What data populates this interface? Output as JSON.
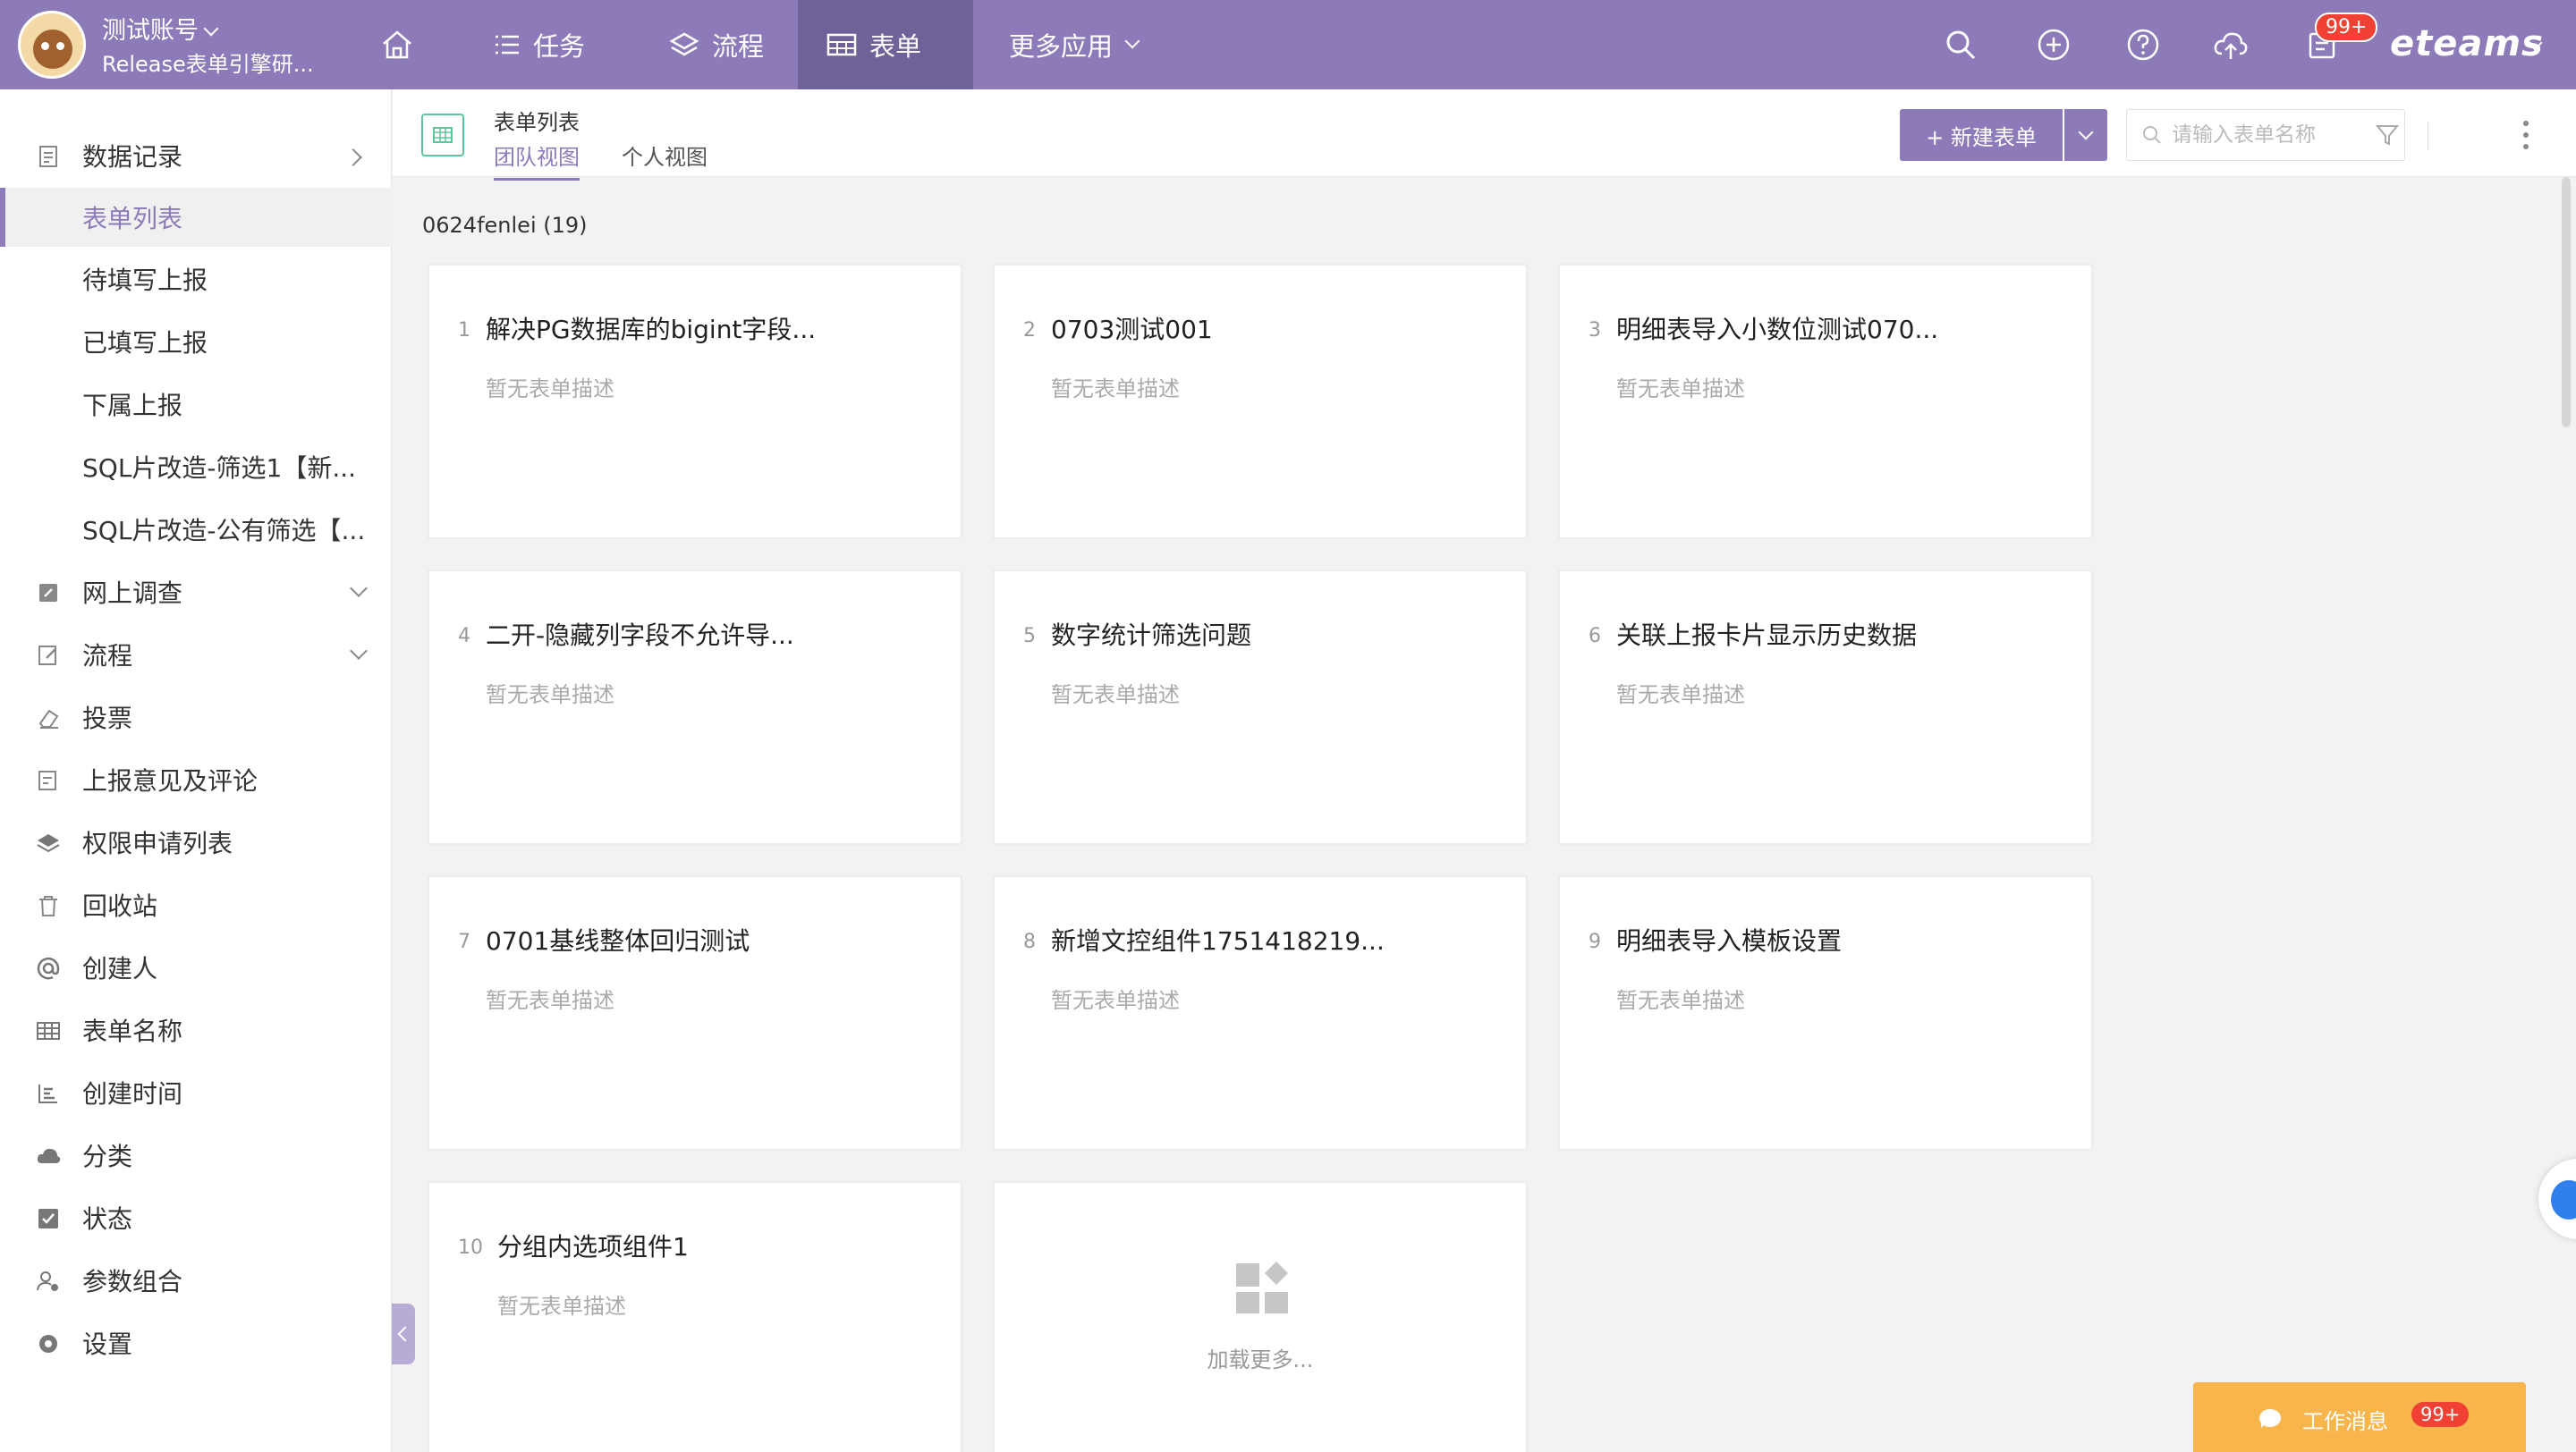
{
  "user": {
    "name": "测试账号",
    "subtitle": "Release表单引擎研..."
  },
  "nav": [
    {
      "label": "任务",
      "icon": "list-icon"
    },
    {
      "label": "流程",
      "icon": "layers-icon"
    },
    {
      "label": "表单",
      "icon": "table-icon"
    },
    {
      "label": "更多应用",
      "icon": "chevron-down-icon"
    }
  ],
  "top_tools": {
    "notification_badge": "99+",
    "brand": "eteams"
  },
  "sidebar": {
    "items": [
      {
        "label": "数据记录",
        "icon": "document-icon"
      },
      {
        "label": "表单列表",
        "icon": ""
      },
      {
        "label": "待填写上报",
        "icon": ""
      },
      {
        "label": "已填写上报",
        "icon": ""
      },
      {
        "label": "下属上报",
        "icon": ""
      },
      {
        "label": "SQL片改造-筛选1【新...",
        "icon": ""
      },
      {
        "label": "SQL片改造-公有筛选【...",
        "icon": ""
      },
      {
        "label": "网上调查",
        "icon": "edit-icon"
      },
      {
        "label": "流程",
        "icon": "flow-edit-icon"
      },
      {
        "label": "投票",
        "icon": "eraser-icon"
      },
      {
        "label": "上报意见及评论",
        "icon": "report-icon"
      },
      {
        "label": "权限申请列表",
        "icon": "layers-icon"
      },
      {
        "label": "回收站",
        "icon": "trash-icon"
      },
      {
        "label": "创建人",
        "icon": "at-icon"
      },
      {
        "label": "表单名称",
        "icon": "table-icon"
      },
      {
        "label": "创建时间",
        "icon": "bar-chart-icon"
      },
      {
        "label": "分类",
        "icon": "cloud-icon"
      },
      {
        "label": "状态",
        "icon": "checkbox-icon"
      },
      {
        "label": "参数组合",
        "icon": "user-settings-icon"
      },
      {
        "label": "设置",
        "icon": "gear-icon"
      }
    ]
  },
  "header": {
    "title": "表单列表",
    "tabs": [
      "团队视图",
      "个人视图"
    ],
    "new_button": "+ 新建表单",
    "search_placeholder": "请输入表单名称"
  },
  "group": {
    "name": "0624fenlei (19)"
  },
  "forms": [
    {
      "num": "1",
      "title": "解决PG数据库的bigint字段...",
      "desc": "暂无表单描述"
    },
    {
      "num": "2",
      "title": "0703测试001",
      "desc": "暂无表单描述"
    },
    {
      "num": "3",
      "title": "明细表导入小数位测试070...",
      "desc": "暂无表单描述"
    },
    {
      "num": "4",
      "title": "二开-隐藏列字段不允许导...",
      "desc": "暂无表单描述"
    },
    {
      "num": "5",
      "title": "数字统计筛选问题",
      "desc": "暂无表单描述"
    },
    {
      "num": "6",
      "title": "关联上报卡片显示历史数据",
      "desc": "暂无表单描述"
    },
    {
      "num": "7",
      "title": "0701基线整体回归测试",
      "desc": "暂无表单描述"
    },
    {
      "num": "8",
      "title": "新增文控组件1751418219...",
      "desc": "暂无表单描述"
    },
    {
      "num": "9",
      "title": "明细表导入模板设置",
      "desc": "暂无表单描述"
    },
    {
      "num": "10",
      "title": "分组内选项组件1",
      "desc": "暂无表单描述"
    }
  ],
  "load_more": "加载更多...",
  "messages": {
    "label": "工作消息",
    "count": "99+"
  },
  "colors": {
    "primary": "#8c7bb8",
    "primary_dark": "#6f6298",
    "badge": "#f04134",
    "message_bar": "#f8b54c"
  }
}
